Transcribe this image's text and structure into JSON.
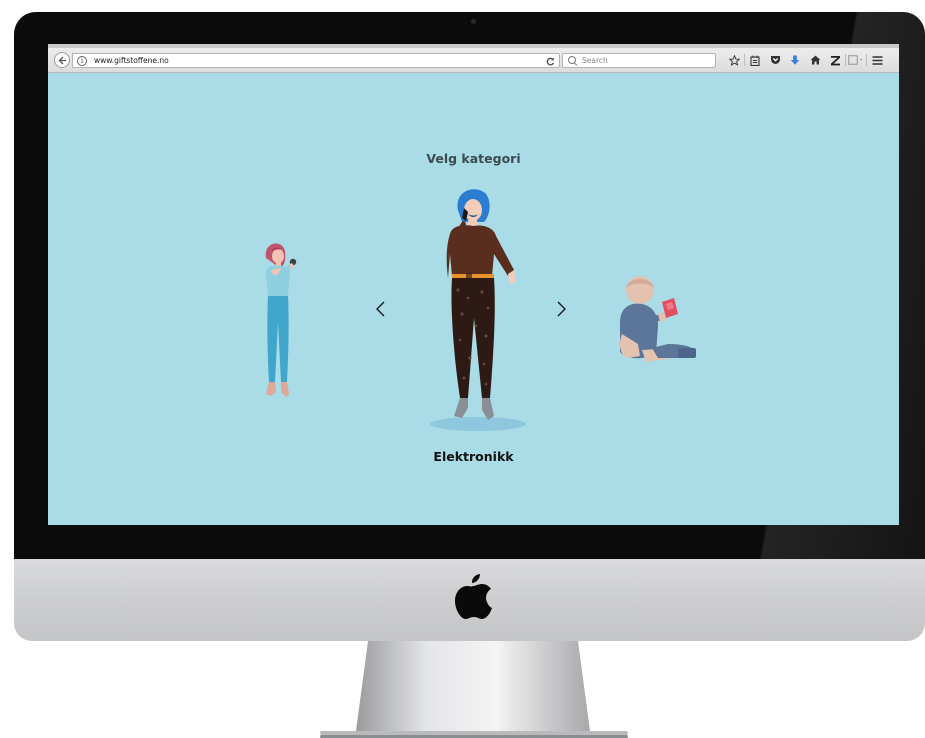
{
  "browser": {
    "url": "www.giftstoffene.no",
    "search_placeholder": "Search",
    "reload_glyph": "C",
    "info_glyph": "i",
    "toolbar_icons": [
      "star-icon",
      "reading-list-icon",
      "pocket-icon",
      "download-icon",
      "home-icon",
      "zotero-icon",
      "screenshot-icon",
      "menu-icon"
    ]
  },
  "page": {
    "heading": "Velg kategori",
    "category": "Elektronikk",
    "prev_glyph": "‹",
    "next_glyph": "›"
  },
  "colors": {
    "page_background": "#a9dce6",
    "bezel": "#0b0b0b",
    "chin": "#cfd0d2",
    "accent_blue": "#3b7fd6"
  }
}
